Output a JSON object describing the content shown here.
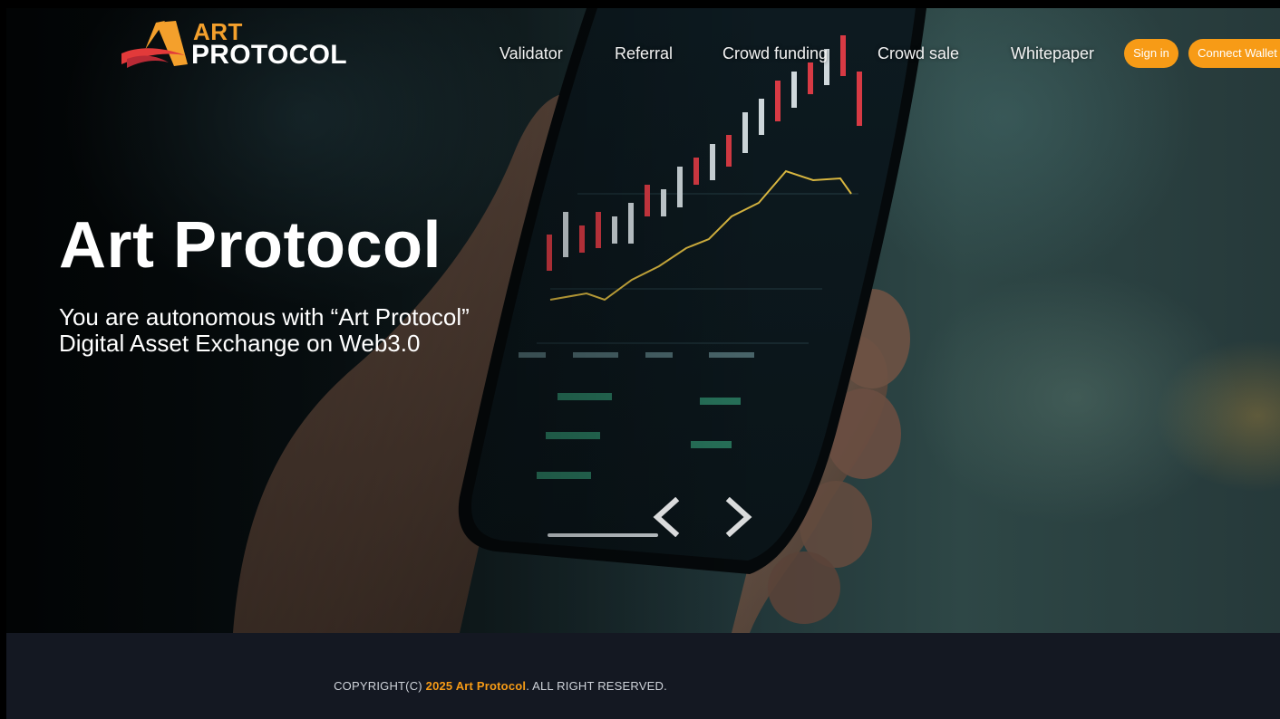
{
  "header": {
    "logo": {
      "line1": "ART",
      "line2": "PROTOCOL",
      "accent_color": "#f4a02c",
      "swoosh_color": "#e23a3a"
    },
    "nav": [
      {
        "label": "Validator"
      },
      {
        "label": "Referral"
      },
      {
        "label": "Crowd funding"
      },
      {
        "label": "Crowd sale"
      },
      {
        "label": "Whitepaper"
      }
    ],
    "sign_in_label": "Sign in",
    "connect_wallet_label": "Connect Wallet",
    "button_color": "#f79b16"
  },
  "hero": {
    "title": "Art Protocol",
    "subtitle_line1": "You are autonomous with “Art Protocol”",
    "subtitle_line2": "Digital Asset Exchange on Web3.0",
    "prev_icon": "chevron-left-icon",
    "next_icon": "chevron-right-icon"
  },
  "footer": {
    "copyright_prefix": "COPYRIGHT(C) ",
    "copyright_brand": "2025 Art Protocol",
    "copyright_suffix": ". ALL RIGHT RESERVED."
  }
}
